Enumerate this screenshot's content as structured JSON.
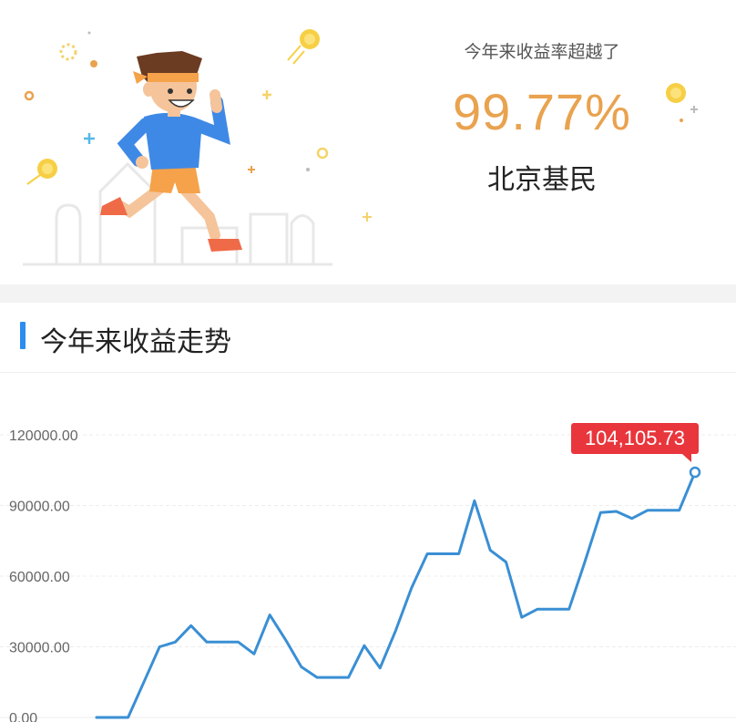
{
  "hero": {
    "beat_label": "今年来收益率超越了",
    "beat_value": "99.77%",
    "beat_group": "北京基民",
    "accent_color": "#e9a24e"
  },
  "section": {
    "title": "今年来收益走势",
    "accent_color": "#2d8cf0"
  },
  "chart_data": {
    "type": "line",
    "title": "",
    "xlabel": "",
    "ylabel": "",
    "ylim": [
      0,
      120000
    ],
    "y_ticks": [
      "120000.00",
      "90000.00",
      "60000.00",
      "30000.00",
      "0.00"
    ],
    "y_tick_values": [
      120000,
      90000,
      60000,
      30000,
      0
    ],
    "grid": true,
    "line_color": "#3a8fd4",
    "series": [
      {
        "values": [
          0,
          0,
          0,
          15000,
          30000,
          32000,
          39000,
          32000,
          32000,
          32000,
          27000,
          43500,
          33000,
          21500,
          17000,
          17000,
          17000,
          30500,
          21000,
          37000,
          55000,
          69500,
          69500,
          69500,
          92000,
          71000,
          66000,
          42500,
          46000,
          46000,
          46000,
          66000,
          87000,
          87500,
          84500,
          88000,
          88000,
          88000,
          104105.73
        ]
      }
    ],
    "highlight": {
      "label": "104,105.73",
      "value": 104105.73,
      "color": "#e8363c"
    }
  }
}
